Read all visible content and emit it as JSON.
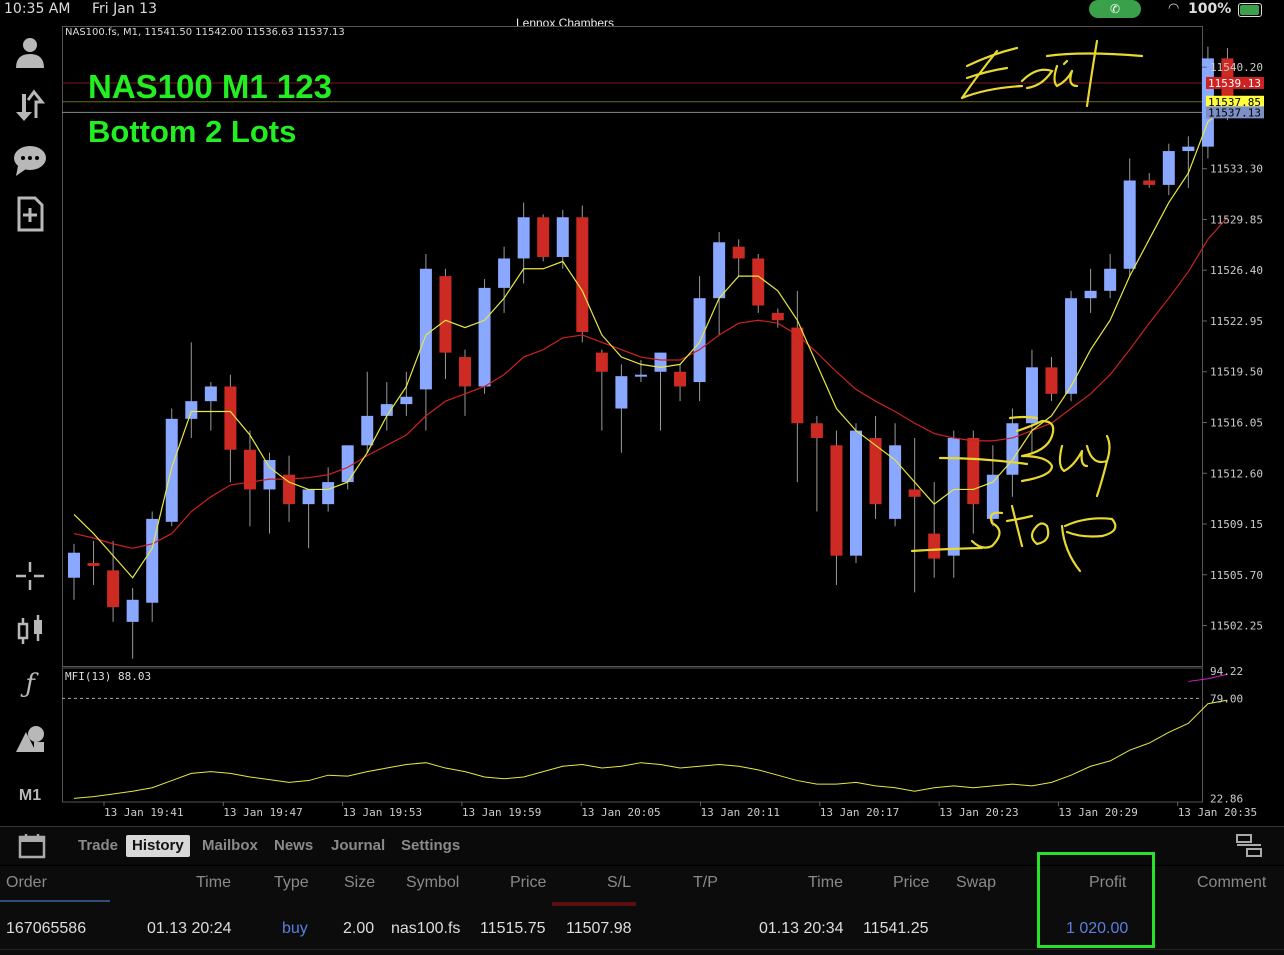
{
  "status": {
    "time": "10:35 AM",
    "date": "Fri Jan 13",
    "window_title": "Lennox Chambers",
    "battery": "100%"
  },
  "chart": {
    "info_line": "NAS100.fs, M1, 11541.50 11542.00 11536.63 11537.13",
    "overlay_title": "NAS100 M1 123",
    "overlay_subtitle": "Bottom 2 Lots",
    "mfi_label": "MFI(13) 88.03",
    "handwritten_notes": [
      "Edit",
      "Buy",
      "stop"
    ],
    "colors": {
      "bull_candle": "#8aa8ff",
      "bear_candle": "#cc2a22",
      "ma_fast": "#e8e840",
      "ma_slow": "#cc2222",
      "mfi_line": "#e8e840",
      "bid_tag": "#ffff40",
      "ask_tag": "#cc2222",
      "annotation_box": "#2ae02a"
    }
  },
  "chart_data": {
    "type": "candlestick",
    "symbol": "NAS100.fs",
    "timeframe": "M1",
    "ylim": [
      11499.5,
      11543.0
    ],
    "y_ticks": [
      11540.2,
      11533.3,
      11529.85,
      11526.4,
      11522.95,
      11519.5,
      11516.05,
      11512.6,
      11509.15,
      11505.7,
      11502.25
    ],
    "x_ticks": [
      "13 Jan 19:41",
      "13 Jan 19:47",
      "13 Jan 19:53",
      "13 Jan 19:59",
      "13 Jan 20:05",
      "13 Jan 20:11",
      "13 Jan 20:17",
      "13 Jan 20:23",
      "13 Jan 20:29",
      "13 Jan 20:35"
    ],
    "price_tags": {
      "ask": "11539.13",
      "bid": "11537.85",
      "last": "11537.13"
    },
    "candles": [
      {
        "o": 11505.5,
        "h": 11507.8,
        "c": 11507.2,
        "l": 11504.0
      },
      {
        "o": 11506.5,
        "h": 11508.0,
        "c": 11506.3,
        "l": 11505.0
      },
      {
        "o": 11506.0,
        "h": 11508.0,
        "c": 11503.5,
        "l": 11502.5
      },
      {
        "o": 11502.5,
        "h": 11504.8,
        "c": 11504.0,
        "l": 11500.0
      },
      {
        "o": 11503.8,
        "h": 11510.0,
        "c": 11509.5,
        "l": 11502.5
      },
      {
        "o": 11509.3,
        "h": 11517.0,
        "c": 11516.3,
        "l": 11509.0
      },
      {
        "o": 11516.3,
        "h": 11521.5,
        "c": 11517.5,
        "l": 11515.0
      },
      {
        "o": 11517.5,
        "h": 11518.8,
        "c": 11518.5,
        "l": 11515.5
      },
      {
        "o": 11518.5,
        "h": 11519.3,
        "c": 11514.2,
        "l": 11512.0
      },
      {
        "o": 11514.2,
        "h": 11515.5,
        "c": 11511.5,
        "l": 11509.0
      },
      {
        "o": 11511.5,
        "h": 11514.0,
        "c": 11513.5,
        "l": 11508.5
      },
      {
        "o": 11512.5,
        "h": 11513.8,
        "c": 11510.5,
        "l": 11509.3
      },
      {
        "o": 11510.5,
        "h": 11511.5,
        "c": 11511.5,
        "l": 11507.5
      },
      {
        "o": 11510.5,
        "h": 11513.0,
        "c": 11512.0,
        "l": 11510.0
      },
      {
        "o": 11512.0,
        "h": 11513.5,
        "c": 11514.5,
        "l": 11511.5
      },
      {
        "o": 11514.5,
        "h": 11519.5,
        "c": 11516.5,
        "l": 11514.0
      },
      {
        "o": 11516.5,
        "h": 11518.8,
        "c": 11517.3,
        "l": 11515.5
      },
      {
        "o": 11517.3,
        "h": 11519.5,
        "c": 11517.8,
        "l": 11516.5
      },
      {
        "o": 11518.3,
        "h": 11527.5,
        "c": 11526.5,
        "l": 11515.5
      },
      {
        "o": 11526.0,
        "h": 11526.5,
        "c": 11520.8,
        "l": 11519.0
      },
      {
        "o": 11520.5,
        "h": 11521.0,
        "c": 11518.5,
        "l": 11516.5
      },
      {
        "o": 11518.5,
        "h": 11525.8,
        "c": 11525.2,
        "l": 11518.0
      },
      {
        "o": 11525.2,
        "h": 11528.0,
        "c": 11527.2,
        "l": 11523.5
      },
      {
        "o": 11527.2,
        "h": 11531.0,
        "c": 11530.0,
        "l": 11525.5
      },
      {
        "o": 11530.0,
        "h": 11530.2,
        "c": 11527.3,
        "l": 11527.0
      },
      {
        "o": 11527.3,
        "h": 11530.5,
        "c": 11530.0,
        "l": 11526.5
      },
      {
        "o": 11530.0,
        "h": 11530.8,
        "c": 11522.2,
        "l": 11521.5
      },
      {
        "o": 11520.8,
        "h": 11521.0,
        "c": 11519.5,
        "l": 11515.5
      },
      {
        "o": 11517.0,
        "h": 11520.0,
        "c": 11519.2,
        "l": 11514.0
      },
      {
        "o": 11519.2,
        "h": 11520.3,
        "c": 11519.3,
        "l": 11518.8
      },
      {
        "o": 11519.5,
        "h": 11520.8,
        "c": 11520.8,
        "l": 11515.5
      },
      {
        "o": 11519.5,
        "h": 11520.0,
        "c": 11518.5,
        "l": 11517.5
      },
      {
        "o": 11518.8,
        "h": 11526.0,
        "c": 11524.5,
        "l": 11517.5
      },
      {
        "o": 11524.5,
        "h": 11529.0,
        "c": 11528.3,
        "l": 11522.0
      },
      {
        "o": 11528.0,
        "h": 11528.5,
        "c": 11527.2,
        "l": 11526.0
      },
      {
        "o": 11527.2,
        "h": 11527.5,
        "c": 11524.0,
        "l": 11523.5
      },
      {
        "o": 11523.5,
        "h": 11523.8,
        "c": 11523.0,
        "l": 11522.5
      },
      {
        "o": 11522.5,
        "h": 11525.0,
        "c": 11516.0,
        "l": 11512.0
      },
      {
        "o": 11516.0,
        "h": 11516.5,
        "c": 11515.0,
        "l": 11510.0
      },
      {
        "o": 11514.5,
        "h": 11515.5,
        "c": 11507.0,
        "l": 11505.0
      },
      {
        "o": 11507.0,
        "h": 11516.0,
        "c": 11515.5,
        "l": 11506.5
      },
      {
        "o": 11515.0,
        "h": 11516.5,
        "c": 11510.5,
        "l": 11509.5
      },
      {
        "o": 11509.5,
        "h": 11516.0,
        "c": 11514.5,
        "l": 11509.0
      },
      {
        "o": 11511.5,
        "h": 11515.0,
        "c": 11511.0,
        "l": 11504.5
      },
      {
        "o": 11508.5,
        "h": 11512.0,
        "c": 11506.8,
        "l": 11505.5
      },
      {
        "o": 11507.0,
        "h": 11515.5,
        "c": 11515.0,
        "l": 11505.5
      },
      {
        "o": 11515.0,
        "h": 11515.5,
        "c": 11510.5,
        "l": 11508.5
      },
      {
        "o": 11509.5,
        "h": 11514.5,
        "c": 11512.5,
        "l": 11509.0
      },
      {
        "o": 11512.5,
        "h": 11517.0,
        "c": 11516.0,
        "l": 11511.0
      },
      {
        "o": 11516.0,
        "h": 11521.0,
        "c": 11519.8,
        "l": 11514.0
      },
      {
        "o": 11519.8,
        "h": 11520.5,
        "c": 11518.0,
        "l": 11517.5
      },
      {
        "o": 11518.0,
        "h": 11525.0,
        "c": 11524.5,
        "l": 11517.5
      },
      {
        "o": 11524.5,
        "h": 11526.5,
        "c": 11525.0,
        "l": 11523.5
      },
      {
        "o": 11525.0,
        "h": 11527.5,
        "c": 11526.5,
        "l": 11524.5
      },
      {
        "o": 11526.5,
        "h": 11534.0,
        "c": 11532.5,
        "l": 11526.0
      },
      {
        "o": 11532.5,
        "h": 11533.0,
        "c": 11532.2,
        "l": 11532.0
      },
      {
        "o": 11532.2,
        "h": 11535.0,
        "c": 11534.5,
        "l": 11531.5
      },
      {
        "o": 11534.5,
        "h": 11535.5,
        "c": 11534.8,
        "l": 11532.0
      },
      {
        "o": 11534.8,
        "h": 11541.6,
        "c": 11540.8,
        "l": 11534.0
      },
      {
        "o": 11540.8,
        "h": 11541.5,
        "c": 11537.13,
        "l": 11536.6
      }
    ],
    "ma_fast": [
      11509.8,
      11508.5,
      11507.0,
      11505.5,
      11507.5,
      11513.0,
      11516.8,
      11516.8,
      11516.8,
      11515.2,
      11513.0,
      11512.0,
      11511.5,
      11511.5,
      11512.0,
      11514.0,
      11516.5,
      11518.5,
      11522.0,
      11523.0,
      11522.5,
      11523.0,
      11524.5,
      11526.5,
      11526.5,
      11527.0,
      11525.0,
      11522.0,
      11520.5,
      11520.0,
      11519.8,
      11520.0,
      11521.5,
      11524.5,
      11526.0,
      11526.0,
      11525.0,
      11523.0,
      11520.0,
      11517.0,
      11515.5,
      11514.5,
      11513.5,
      11512.0,
      11510.5,
      11511.5,
      11511.5,
      11512.0,
      11513.5,
      11515.5,
      11516.5,
      11518.5,
      11521.0,
      11523.0,
      11526.0,
      11528.5,
      11531.0,
      11533.0,
      11536.5,
      11537.5
    ],
    "ma_slow": [
      11508.5,
      11508.2,
      11507.8,
      11507.5,
      11507.8,
      11508.5,
      11510.0,
      11511.0,
      11511.8,
      11512.0,
      11512.2,
      11512.2,
      11512.3,
      11512.5,
      11513.0,
      11513.8,
      11514.5,
      11515.2,
      11516.5,
      11517.5,
      11518.0,
      11518.5,
      11519.3,
      11520.5,
      11521.0,
      11521.8,
      11522.0,
      11521.5,
      11521.0,
      11520.5,
      11520.3,
      11520.3,
      11521.0,
      11522.0,
      11522.8,
      11523.0,
      11522.8,
      11522.0,
      11520.8,
      11519.5,
      11518.3,
      11517.5,
      11516.8,
      11516.0,
      11515.3,
      11515.0,
      11514.8,
      11514.8,
      11515.0,
      11515.5,
      11516.0,
      11517.0,
      11518.0,
      11519.3,
      11521.0,
      11522.8,
      11524.5,
      11526.3,
      11528.5,
      11530.0
    ],
    "mfi": {
      "title": "MFI(13) 88.03",
      "value": 88.03,
      "ylim": [
        21.0,
        96.0
      ],
      "y_ticks": [
        94.22,
        79.0,
        22.86
      ],
      "level": 79.0,
      "values": [
        23.0,
        24.0,
        25.5,
        27.0,
        29.0,
        33.0,
        37.0,
        38.0,
        37.0,
        35.0,
        33.5,
        32.0,
        33.0,
        36.0,
        35.5,
        38.0,
        40.0,
        42.0,
        43.0,
        40.0,
        38.0,
        35.0,
        34.0,
        35.0,
        38.0,
        41.0,
        42.0,
        40.0,
        41.0,
        43.0,
        42.0,
        40.0,
        41.0,
        42.0,
        41.0,
        39.0,
        36.0,
        33.0,
        31.0,
        31.0,
        32.0,
        30.0,
        29.0,
        27.0,
        29.0,
        30.0,
        29.0,
        30.0,
        31.0,
        30.0,
        32.0,
        36.0,
        41.0,
        44.0,
        50.0,
        54.0,
        60.0,
        65.0,
        76.0,
        78.0
      ],
      "signal_tail": [
        84.0,
        85.5,
        88.03
      ]
    }
  },
  "tabs": [
    {
      "label": "Trade",
      "active": false
    },
    {
      "label": "History",
      "active": true
    },
    {
      "label": "Mailbox",
      "active": false
    },
    {
      "label": "News",
      "active": false
    },
    {
      "label": "Journal",
      "active": false
    },
    {
      "label": "Settings",
      "active": false
    }
  ],
  "history": {
    "columns": [
      "Order",
      "Time",
      "Type",
      "Size",
      "Symbol",
      "Price",
      "S/L",
      "T/P",
      "Time",
      "Price",
      "Swap",
      "Profit",
      "Comment"
    ],
    "row": {
      "order": "167065586",
      "open_time": "01.13 20:24",
      "type": "buy",
      "size": "2.00",
      "symbol": "nas100.fs",
      "open_price": "11515.75",
      "sl": "11507.98",
      "tp": "",
      "close_time": "01.13 20:34",
      "close_price": "11541.25",
      "swap": "",
      "profit": "1 020.00",
      "comment": ""
    }
  },
  "toolbar": {
    "timeframe": "M1"
  }
}
